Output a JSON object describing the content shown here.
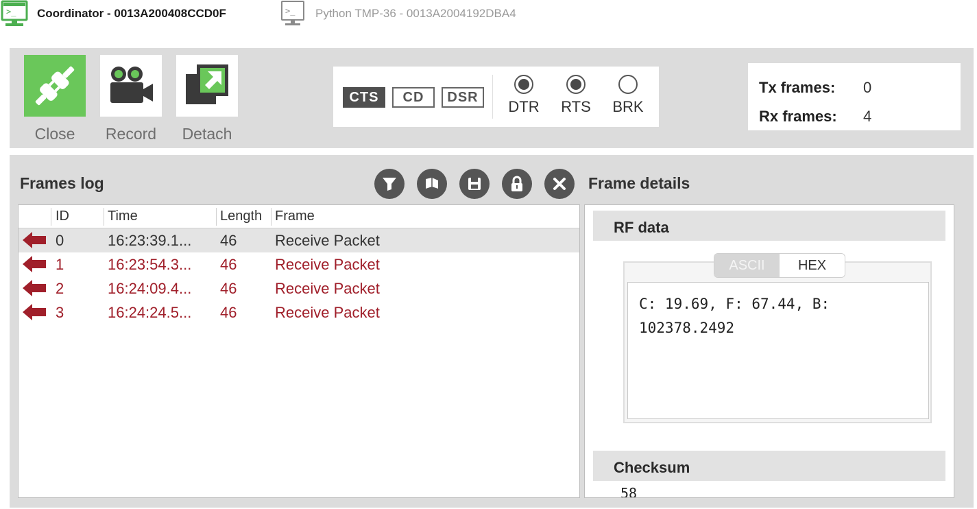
{
  "device_tabs": [
    {
      "label": "Coordinator - 0013A200408CCD0F",
      "active": true,
      "icon": "terminal-monitor-icon"
    },
    {
      "label": "Python TMP-36 - 0013A2004192DBA4",
      "active": false,
      "icon": "terminal-monitor-icon"
    }
  ],
  "toolbar": {
    "close_label": "Close",
    "record_label": "Record",
    "detach_label": "Detach"
  },
  "lines": {
    "cts": "CTS",
    "cd": "CD",
    "dsr": "DSR",
    "dtr": "DTR",
    "rts": "RTS",
    "brk": "BRK",
    "dtr_checked": true,
    "rts_checked": true,
    "brk_checked": false
  },
  "counters": {
    "tx_label": "Tx frames:",
    "tx_value": "0",
    "rx_label": "Rx frames:",
    "rx_value": "4"
  },
  "frames_log": {
    "title": "Frames log",
    "columns": {
      "id": "ID",
      "time": "Time",
      "length": "Length",
      "frame": "Frame"
    },
    "rows": [
      {
        "id": "0",
        "time": "16:23:39.1...",
        "length": "46",
        "frame": "Receive Packet"
      },
      {
        "id": "1",
        "time": "16:23:54.3...",
        "length": "46",
        "frame": "Receive Packet"
      },
      {
        "id": "2",
        "time": "16:24:09.4...",
        "length": "46",
        "frame": "Receive Packet"
      },
      {
        "id": "3",
        "time": "16:24:24.5...",
        "length": "46",
        "frame": "Receive Packet"
      }
    ]
  },
  "frame_details": {
    "title": "Frame details",
    "rf_data_title": "RF data",
    "view_ascii": "ASCII",
    "view_hex": "HEX",
    "rf_line1": "C: 19.69, F: 67.44, B:",
    "rf_line2": "102378.2492",
    "checksum_title": "Checksum",
    "checksum_value": "58"
  },
  "colors": {
    "accent_green": "#6ac75a",
    "incoming_frame_red": "#a01f2a",
    "panel_gray": "#dcdcdc"
  }
}
